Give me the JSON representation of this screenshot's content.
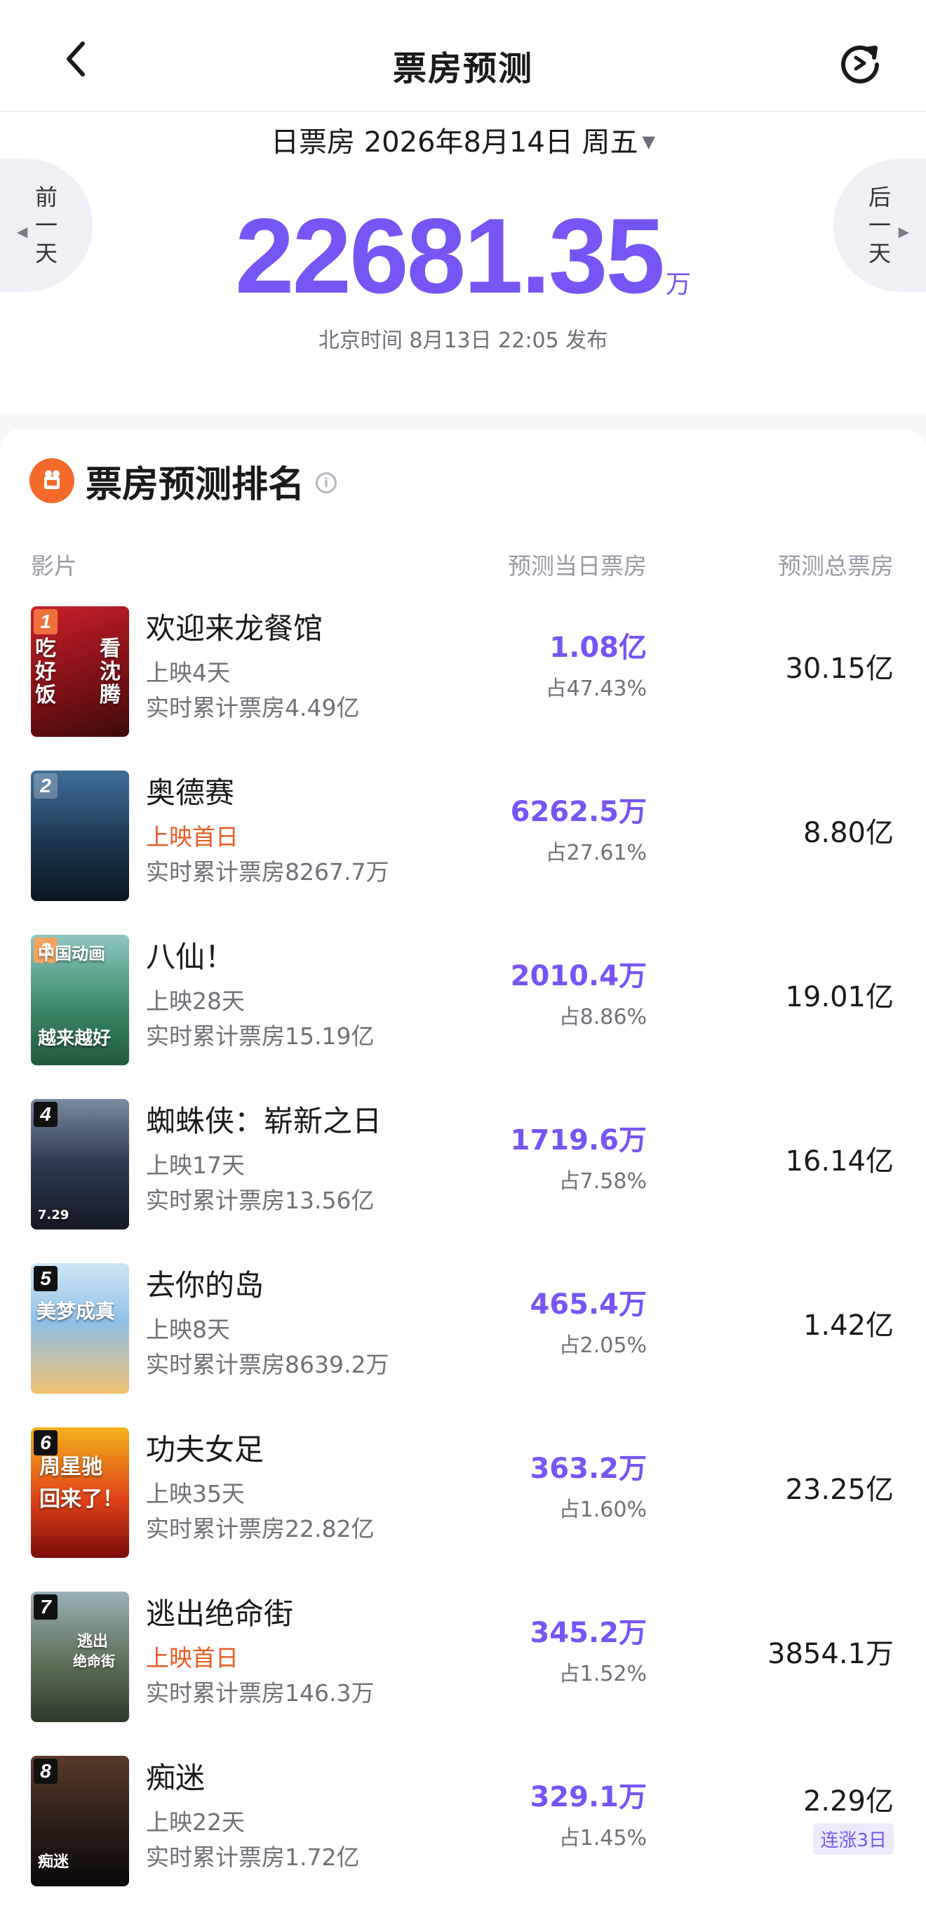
{
  "header": {
    "title": "票房预测"
  },
  "summary": {
    "date_label": "日票房",
    "date": "2026年8月14日 周五",
    "prev_day": [
      "前",
      "一",
      "天"
    ],
    "next_day": [
      "后",
      "一",
      "天"
    ],
    "amount": "22681.35",
    "unit": "万",
    "publish_time": "北京时间 8月13日 22:05 发布"
  },
  "ranking": {
    "title": "票房预测排名",
    "columns": {
      "film": "影片",
      "day_box": "预测当日票房",
      "total_box": "预测总票房"
    },
    "films": [
      {
        "rank": "1",
        "name": "欢迎来龙餐馆",
        "days": "上映4天",
        "first_day": false,
        "cumulative": "实时累计票房4.49亿",
        "day_box": "1.08亿",
        "share": "占47.43%",
        "total": "30.15亿",
        "tag": "",
        "poster_text": [
          "吃好饭",
          "看沈腾"
        ]
      },
      {
        "rank": "2",
        "name": "奥德赛",
        "days": "上映首日",
        "first_day": true,
        "cumulative": "实时累计票房8267.7万",
        "day_box": "6262.5万",
        "share": "占27.61%",
        "total": "8.80亿",
        "tag": "",
        "poster_text": []
      },
      {
        "rank": "3",
        "name": "八仙！",
        "days": "上映28天",
        "first_day": false,
        "cumulative": "实时累计票房15.19亿",
        "day_box": "2010.4万",
        "share": "占8.86%",
        "total": "19.01亿",
        "tag": "",
        "poster_text": [
          "中国动画",
          "越来越好"
        ]
      },
      {
        "rank": "4",
        "name": "蜘蛛侠：崭新之日",
        "days": "上映17天",
        "first_day": false,
        "cumulative": "实时累计票房13.56亿",
        "day_box": "1719.6万",
        "share": "占7.58%",
        "total": "16.14亿",
        "tag": "",
        "poster_text": [
          "7.29"
        ]
      },
      {
        "rank": "5",
        "name": "去你的岛",
        "days": "上映8天",
        "first_day": false,
        "cumulative": "实时累计票房8639.2万",
        "day_box": "465.4万",
        "share": "占2.05%",
        "total": "1.42亿",
        "tag": "",
        "poster_text": [
          "美梦成真"
        ]
      },
      {
        "rank": "6",
        "name": "功夫女足",
        "days": "上映35天",
        "first_day": false,
        "cumulative": "实时累计票房22.82亿",
        "day_box": "363.2万",
        "share": "占1.60%",
        "total": "23.25亿",
        "tag": "",
        "poster_text": [
          "周星驰",
          "回来了！"
        ]
      },
      {
        "rank": "7",
        "name": "逃出绝命街",
        "days": "上映首日",
        "first_day": true,
        "cumulative": "实时累计票房146.3万",
        "day_box": "345.2万",
        "share": "占1.52%",
        "total": "3854.1万",
        "tag": "",
        "poster_text": [
          "逃出",
          "绝命街"
        ]
      },
      {
        "rank": "8",
        "name": "痴迷",
        "days": "上映22天",
        "first_day": false,
        "cumulative": "实时累计票房1.72亿",
        "day_box": "329.1万",
        "share": "占1.45%",
        "total": "2.29亿",
        "tag": "连涨3日",
        "poster_text": [
          "痴迷"
        ]
      }
    ]
  },
  "colors": {
    "accent": "#7755f5",
    "first_day": "#ea5b25",
    "logo": "#f36a2a"
  }
}
